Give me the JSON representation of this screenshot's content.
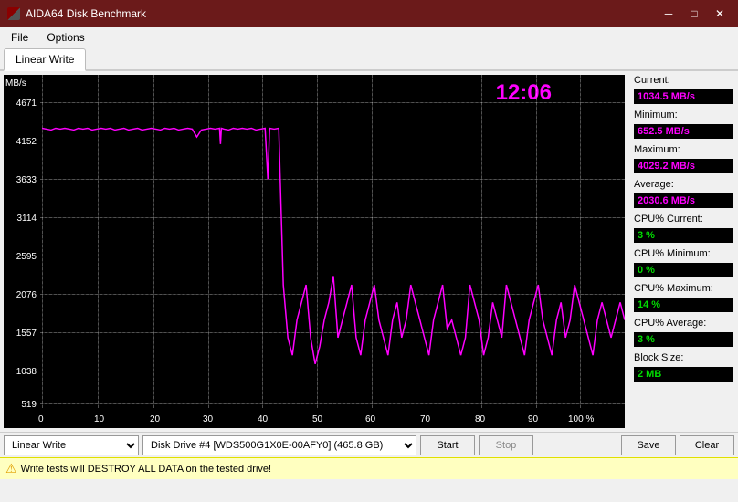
{
  "titleBar": {
    "title": "AIDA64 Disk Benchmark",
    "controls": {
      "minimize": "─",
      "maximize": "□",
      "close": "✕"
    }
  },
  "menuBar": {
    "items": [
      "File",
      "Options"
    ]
  },
  "tabs": [
    {
      "label": "Linear Write",
      "active": true
    }
  ],
  "chart": {
    "yAxis": {
      "unit": "MB/s",
      "labels": [
        "4671",
        "4152",
        "3633",
        "3114",
        "2595",
        "2076",
        "1557",
        "1038",
        "519"
      ]
    },
    "xAxis": {
      "labels": [
        "0",
        "10",
        "20",
        "30",
        "40",
        "50",
        "60",
        "70",
        "80",
        "90",
        "100 %"
      ]
    },
    "timeDisplay": "12:06"
  },
  "stats": {
    "current_label": "Current:",
    "current_value": "1034.5 MB/s",
    "minimum_label": "Minimum:",
    "minimum_value": "652.5 MB/s",
    "maximum_label": "Maximum:",
    "maximum_value": "4029.2 MB/s",
    "average_label": "Average:",
    "average_value": "2030.6 MB/s",
    "cpu_current_label": "CPU% Current:",
    "cpu_current_value": "3 %",
    "cpu_minimum_label": "CPU% Minimum:",
    "cpu_minimum_value": "0 %",
    "cpu_maximum_label": "CPU% Maximum:",
    "cpu_maximum_value": "14 %",
    "cpu_average_label": "CPU% Average:",
    "cpu_average_value": "3 %",
    "block_size_label": "Block Size:",
    "block_size_value": "2 MB"
  },
  "controls": {
    "test_type": "Linear Write",
    "disk": "Disk Drive #4  [WDS500G1X0E-00AFY0]  (465.8 GB)",
    "start": "Start",
    "stop": "Stop",
    "save": "Save",
    "clear": "Clear"
  },
  "warning": {
    "text": "Write tests will DESTROY ALL DATA on the tested drive!"
  }
}
